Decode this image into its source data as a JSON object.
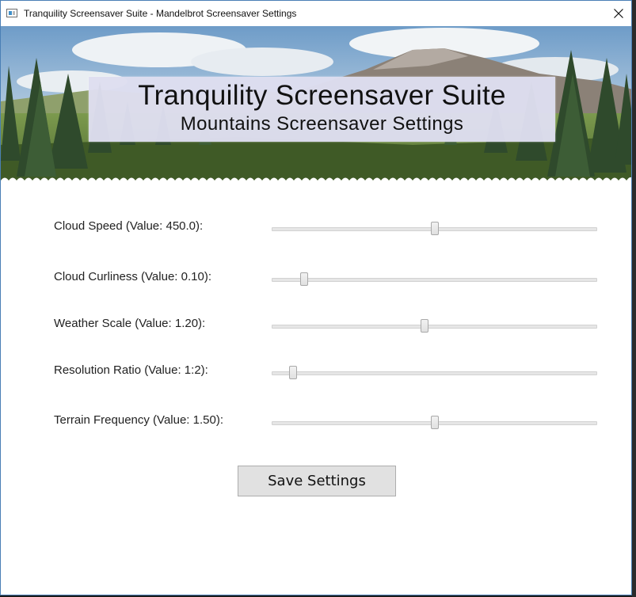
{
  "window": {
    "title": "Tranquility Screensaver Suite - Mandelbrot Screensaver Settings",
    "app_icon": "window-app-icon",
    "close_icon": "close-icon"
  },
  "banner": {
    "title": "Tranquility Screensaver Suite",
    "subtitle": "Mountains Screensaver Settings",
    "image": "mountain-forest-landscape"
  },
  "settings": [
    {
      "label": "Cloud Speed (Value: 450.0):",
      "level": 0.5
    },
    {
      "label": "Cloud Curliness (Value: 0.10):",
      "level": 0.1
    },
    {
      "label": "Weather Scale (Value: 1.20):",
      "level": 0.47
    },
    {
      "label": "Resolution Ratio (Value: 1:2):",
      "level": 0.065
    },
    {
      "label": "Terrain Frequency (Value: 1.50):",
      "level": 0.5
    }
  ],
  "save_button": {
    "label": "Save Settings"
  },
  "colors": {
    "window_border": "#4a7fb5",
    "banner_box": "#dedef0",
    "button_bg": "#e1e1e1"
  }
}
